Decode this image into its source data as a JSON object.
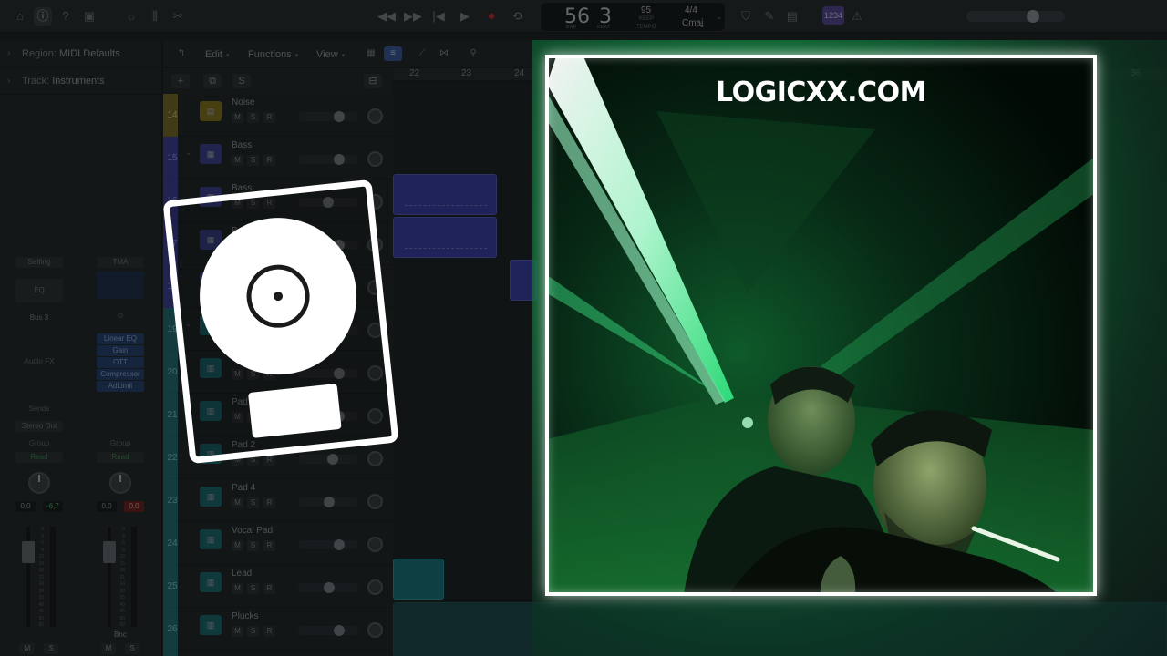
{
  "toolbar": {
    "left_icons": [
      "inbox-icon",
      "info-icon",
      "help-icon",
      "library-icon",
      "brightness-icon",
      "mixer-icon",
      "scissors-icon"
    ],
    "transport": {
      "rewind": "◀◀",
      "forward": "▶▶",
      "to_start": "|◀",
      "play": "▶",
      "record": "●",
      "cycle": "⟲"
    },
    "lcd": {
      "bar": "56",
      "beat": "3",
      "bar_label": "BAR",
      "beat_label": "BEAT",
      "tempo": "95",
      "keep_label": "KEEP",
      "tempo_label": "TEMPO",
      "signature": "4/4",
      "key": "Cmaj"
    },
    "badge": "1234"
  },
  "inspector": {
    "region_label": "Region:",
    "region_value": "MIDI Defaults",
    "track_label": "Track:",
    "track_value": "Instruments",
    "strip1": {
      "setting": "Setting",
      "eq": "EQ",
      "bus": "Bus 3",
      "audio_fx": "Audio FX",
      "sends": "Sends",
      "output": "Stereo Out",
      "group": "Group",
      "automation": "Read",
      "readout_left": "0,0",
      "readout_right": "-6,7",
      "mute": "M",
      "solo": "S"
    },
    "strip2": {
      "setting": "TMA",
      "fx": [
        "Linear EQ",
        "Gain",
        "OTT",
        "Compressor",
        "AdLimit"
      ],
      "group": "Group",
      "automation": "Read",
      "readout_left": "0,0",
      "readout_right": "0,0",
      "name": "Bnc",
      "mute": "M",
      "solo": "S"
    },
    "fader_scale": [
      "0",
      "3",
      "6",
      "9",
      "12",
      "15",
      "18",
      "21",
      "24",
      "30",
      "35",
      "40",
      "45",
      "50",
      "60"
    ]
  },
  "tracks_toolbar": {
    "edit": "Edit",
    "functions": "Functions",
    "view": "View",
    "add": "+",
    "solo_all": "S"
  },
  "ruler": {
    "bars": [
      "22",
      "23",
      "24",
      "36"
    ]
  },
  "tracks": [
    {
      "num": "14",
      "name": "Noise",
      "vol": 0.72
    },
    {
      "num": "15",
      "name": "Bass",
      "vol": 0.72
    },
    {
      "num": "16",
      "name": "Bass",
      "vol": 0.5
    },
    {
      "num": "17",
      "name": "B",
      "vol": 0.72
    },
    {
      "num": "18",
      "name": "",
      "vol": 0.72
    },
    {
      "num": "19",
      "name": "",
      "vol": 0.72
    },
    {
      "num": "20",
      "name": "",
      "vol": 0.72
    },
    {
      "num": "21",
      "name": "Pad",
      "vol": 0.72
    },
    {
      "num": "22",
      "name": "Pad 2",
      "vol": 0.6
    },
    {
      "num": "23",
      "name": "Pad 4",
      "vol": 0.52
    },
    {
      "num": "24",
      "name": "Vocal Pad",
      "vol": 0.72
    },
    {
      "num": "25",
      "name": "Lead",
      "vol": 0.52
    },
    {
      "num": "26",
      "name": "Plucks",
      "vol": 0.72
    }
  ],
  "track_buttons": {
    "mute": "M",
    "solo": "S",
    "record": "R"
  },
  "overlay": {
    "logo_text": "LOGICXX.COM"
  }
}
